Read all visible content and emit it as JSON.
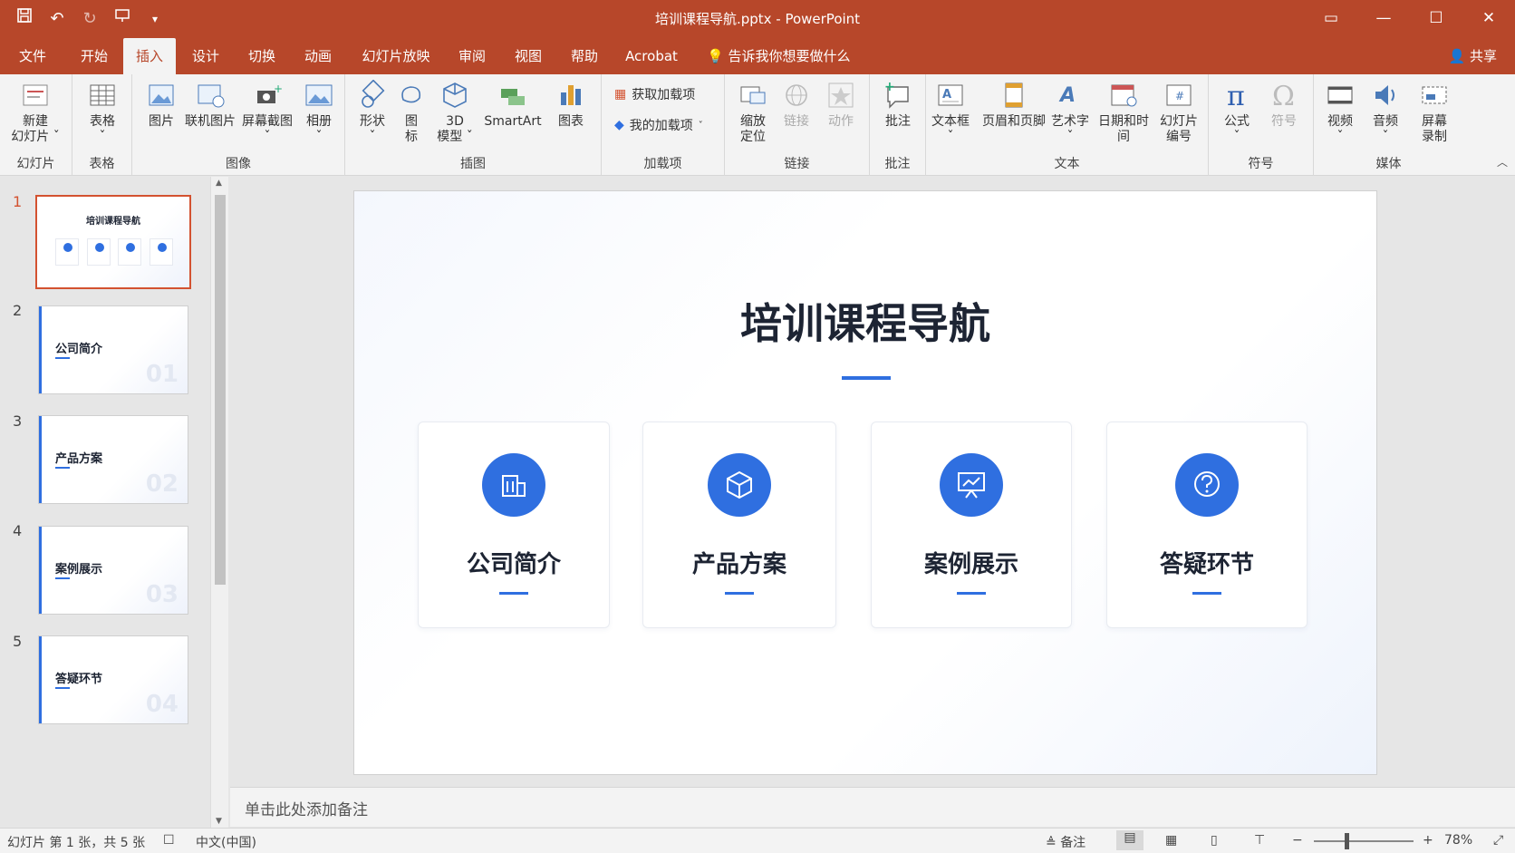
{
  "window": {
    "title": "培训课程导航.pptx - PowerPoint",
    "colors": {
      "accent": "#b7472a",
      "slide_blue": "#2f6fe0"
    }
  },
  "menu": {
    "tabs": [
      "文件",
      "开始",
      "插入",
      "设计",
      "切换",
      "动画",
      "幻灯片放映",
      "审阅",
      "视图",
      "帮助",
      "Acrobat"
    ],
    "active_tab": "插入",
    "tell_me": "告诉我你想要做什么",
    "share": "共享"
  },
  "ribbon": {
    "groups": {
      "slides": {
        "label": "幻灯片",
        "new_slide": "新建\n幻灯片 ˇ"
      },
      "tables": {
        "label": "表格",
        "table": "表格\nˇ"
      },
      "images": {
        "label": "图像",
        "picture": "图片",
        "online_picture": "联机图片",
        "screenshot": "屏幕截图\nˇ",
        "album": "相册\nˇ"
      },
      "illustrations": {
        "label": "插图",
        "shapes": "形状\nˇ",
        "icons": "图\n标",
        "model3d": "3D\n模型 ˇ",
        "smartart": "SmartArt",
        "chart": "图表"
      },
      "addins": {
        "label": "加载项",
        "get_addins": "获取加载项",
        "my_addins": "我的加载项"
      },
      "links": {
        "label": "链接",
        "zoom": "缩放\n定位",
        "link": "链接",
        "action": "动作"
      },
      "comments": {
        "label": "批注",
        "comment": "批注"
      },
      "text": {
        "label": "文本",
        "textbox": "文本框\nˇ",
        "header_footer": "页眉和页脚",
        "wordart": "艺术字\nˇ",
        "datetime": "日期和时间",
        "slide_number": "幻灯片\n编号"
      },
      "symbols": {
        "label": "符号",
        "equation": "公式\nˇ",
        "symbol": "符号"
      },
      "media": {
        "label": "媒体",
        "video": "视频\nˇ",
        "audio": "音频\nˇ",
        "screen_recording": "屏幕\n录制"
      }
    }
  },
  "thumbnails": [
    {
      "num": "1",
      "title": "培训课程导航",
      "selected": true
    },
    {
      "num": "2",
      "title": "公司简介",
      "index": "01"
    },
    {
      "num": "3",
      "title": "产品方案",
      "index": "02"
    },
    {
      "num": "4",
      "title": "案例展示",
      "index": "03"
    },
    {
      "num": "5",
      "title": "答疑环节",
      "index": "04"
    }
  ],
  "slide": {
    "title": "培训课程导航",
    "cards": [
      {
        "label": "公司简介",
        "icon": "building-icon"
      },
      {
        "label": "产品方案",
        "icon": "cube-icon"
      },
      {
        "label": "案例展示",
        "icon": "presentation-chart-icon"
      },
      {
        "label": "答疑环节",
        "icon": "question-icon"
      }
    ]
  },
  "notes": {
    "placeholder": "单击此处添加备注"
  },
  "status": {
    "slide_info": "幻灯片 第 1 张，共 5 张",
    "language": "中文(中国)",
    "notes_btn": "备注",
    "zoom": "78%",
    "zoom_minus": "−",
    "zoom_plus": "+"
  }
}
